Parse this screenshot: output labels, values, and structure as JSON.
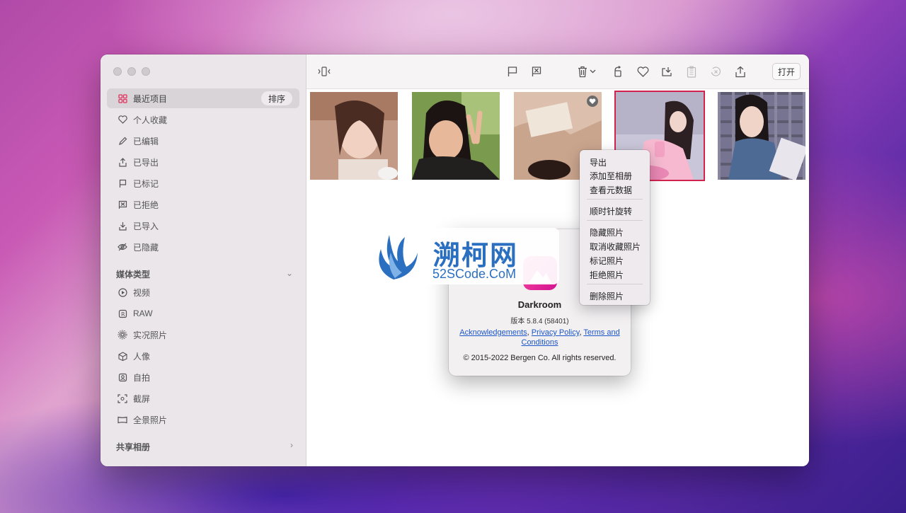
{
  "sidebar": {
    "recent": "最近项目",
    "sort": "排序",
    "items": [
      "个人收藏",
      "已编辑",
      "已导出",
      "已标记",
      "已拒绝",
      "已导入",
      "已隐藏"
    ],
    "media_header": "媒体类型",
    "media_items": [
      "视频",
      "RAW",
      "实况照片",
      "人像",
      "自拍",
      "截屏",
      "全景照片"
    ],
    "shared_header": "共享相册"
  },
  "toolbar": {
    "open": "打开"
  },
  "context_menu": {
    "items": [
      "导出",
      "添加至相册",
      "查看元数据",
      "顺时针旋转",
      "隐藏照片",
      "取消收藏照片",
      "标记照片",
      "拒绝照片",
      "删除照片"
    ]
  },
  "about": {
    "app_name": "Darkroom",
    "version": "版本 5.8.4 (58401)",
    "ack": "Acknowledgements",
    "privacy": "Privacy Policy",
    "terms": "Terms and Conditions",
    "copyright": "© 2015-2022 Bergen Co. All rights reserved."
  },
  "watermark": {
    "title": "溯柯网",
    "subtitle": "52SCode.CoM"
  },
  "colors": {
    "accent": "#d2234f",
    "link": "#1b56c8",
    "brand": "#2b6fc0"
  }
}
